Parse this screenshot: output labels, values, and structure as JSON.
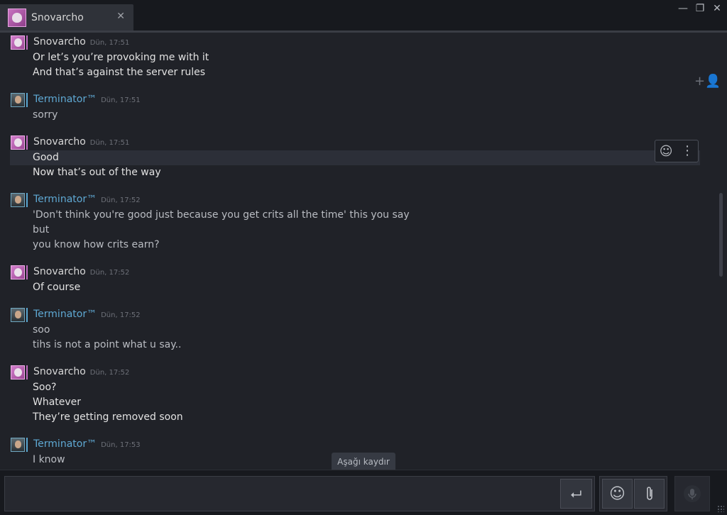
{
  "tab": {
    "title": "Snovarcho",
    "close_glyph": "✕"
  },
  "window": {
    "minimize": "—",
    "restore": "❐",
    "close": "✕"
  },
  "colors": {
    "snov_accent": "#c06ac0",
    "term_accent": "#5aa6d0",
    "term_name": "#5fa9d4"
  },
  "messages": [
    {
      "author": "Snovarcho",
      "time": "Dün, 17:51",
      "lines": [
        "Or let’s you’re provoking me with it",
        "And that’s against the server rules"
      ]
    },
    {
      "author": "Terminator™",
      "time": "Dün, 17:51",
      "lines": [
        "sorry"
      ]
    },
    {
      "author": "Snovarcho",
      "time": "Dün, 17:51",
      "lines": [
        "Good",
        "Now that’s out of the way"
      ]
    },
    {
      "author": "Terminator™",
      "time": "Dün, 17:52",
      "lines": [
        "'Don't think you're good just because you get crits all the time' this you say",
        "but",
        "you know how crits earn?"
      ]
    },
    {
      "author": "Snovarcho",
      "time": "Dün, 17:52",
      "lines": [
        "Of course"
      ]
    },
    {
      "author": "Terminator™",
      "time": "Dün, 17:52",
      "lines": [
        "soo",
        "tihs is not a point what u say.."
      ]
    },
    {
      "author": "Snovarcho",
      "time": "Dün, 17:52",
      "lines": [
        "Soo?",
        "Whatever",
        "They’re getting removed soon"
      ]
    },
    {
      "author": "Terminator™",
      "time": "Dün, 17:53",
      "lines": [
        "I know"
      ]
    }
  ],
  "scroll_down_label": "Aşağı kaydır",
  "icons": {
    "send": "⮠",
    "emoji": "☺",
    "attach": "📎",
    "voice": "🎙",
    "add_friend": "+👤",
    "react": "☺",
    "more": "⋮"
  }
}
